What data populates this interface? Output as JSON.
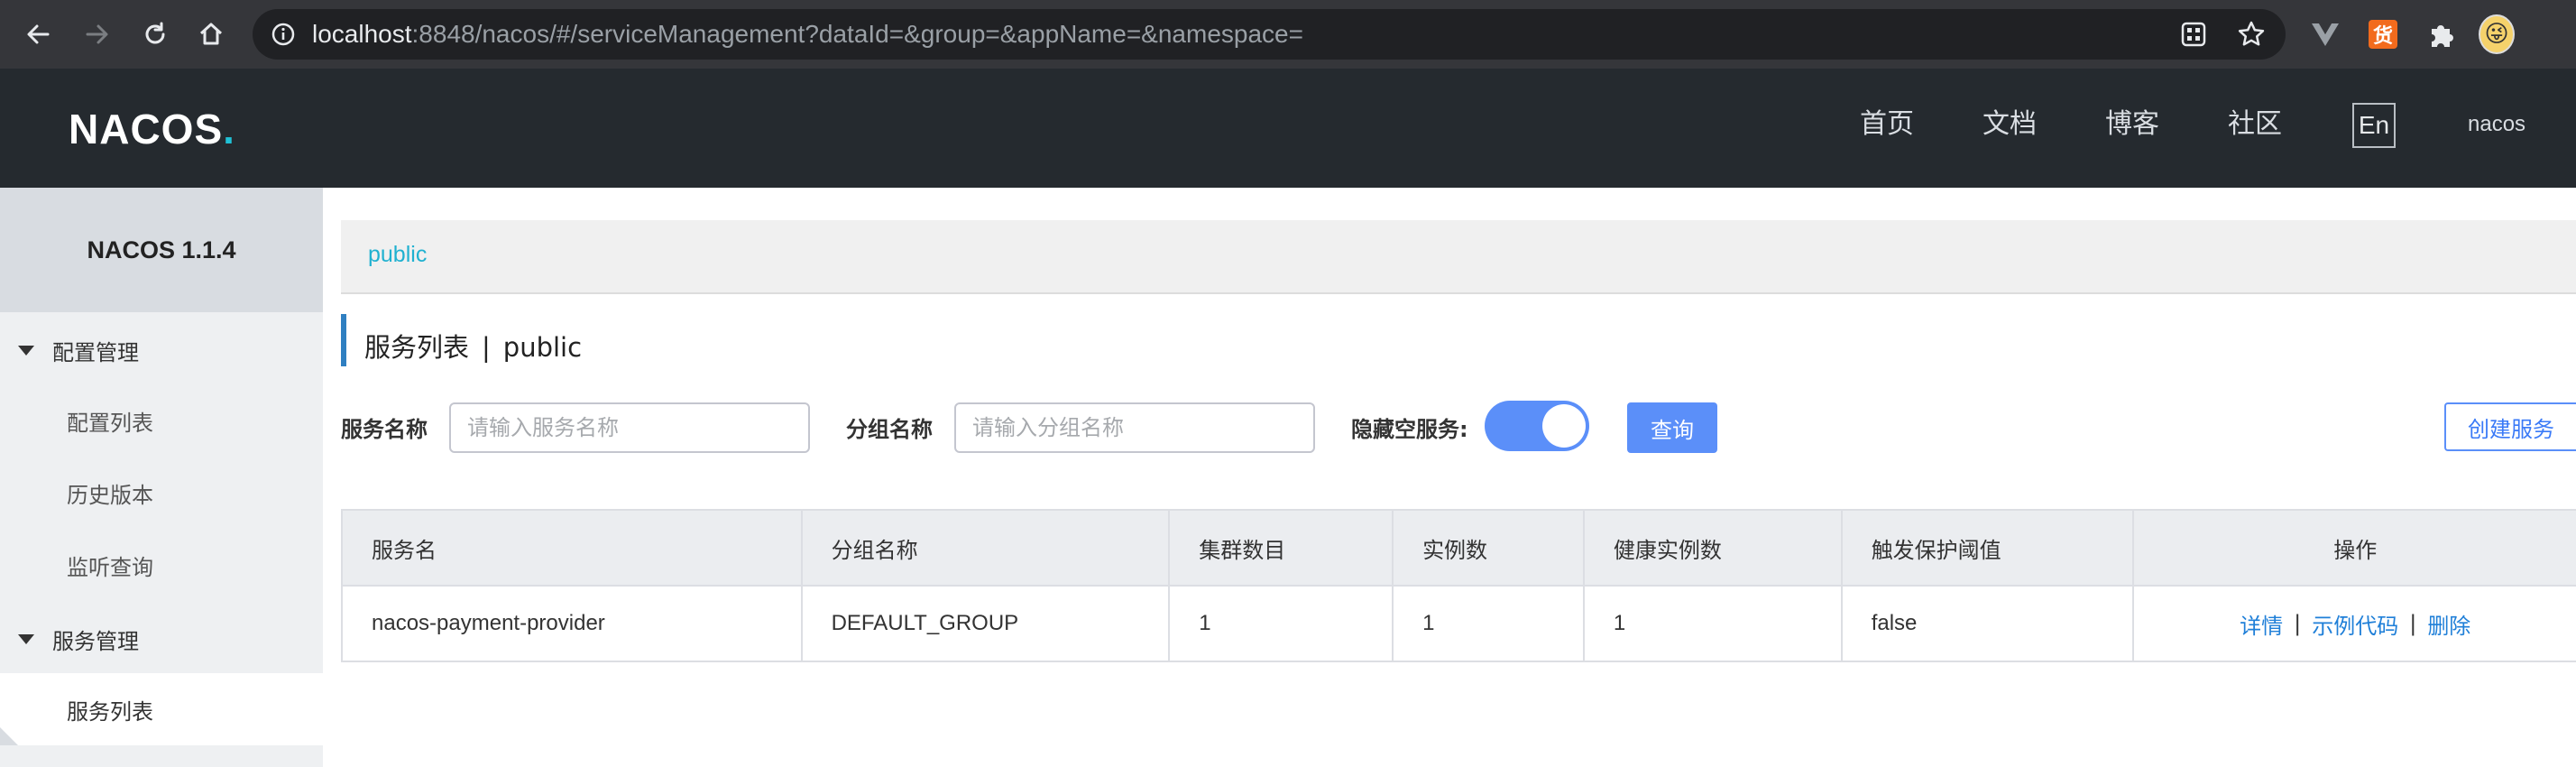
{
  "browser": {
    "url_host": "localhost",
    "url_rest": ":8848/nacos/#/serviceManagement?dataId=&group=&appName=&namespace=",
    "icons": [
      "back-icon",
      "forward-icon",
      "reload-icon",
      "home-icon",
      "info-icon",
      "qr-code-icon",
      "bookmark-star-icon",
      "vue-devtools-icon",
      "extension-badge-icon",
      "extensions-puzzle-icon",
      "profile-avatar-icon"
    ],
    "extension_badge_text": "货"
  },
  "header": {
    "logo_main": "NACOS",
    "logo_dot": ".",
    "nav": [
      "首页",
      "文档",
      "博客",
      "社区"
    ],
    "lang_button": "En",
    "user": "nacos"
  },
  "sidebar": {
    "version": "NACOS 1.1.4",
    "groups": [
      {
        "label": "配置管理",
        "items": [
          "配置列表",
          "历史版本",
          "监听查询"
        ]
      },
      {
        "label": "服务管理",
        "items": [
          "服务列表"
        ]
      }
    ]
  },
  "namespace_bar": {
    "link": "public"
  },
  "page": {
    "title": "服务列表",
    "separator": "|",
    "namespace": "public"
  },
  "filters": {
    "service_name_label": "服务名称",
    "service_name_placeholder": "请输入服务名称",
    "service_name_value": "",
    "group_name_label": "分组名称",
    "group_name_placeholder": "请输入分组名称",
    "group_name_value": "",
    "hide_empty_label": "隐藏空服务:",
    "hide_empty_on": true,
    "query_button": "查询",
    "create_button": "创建服务"
  },
  "table": {
    "headers": [
      "服务名",
      "分组名称",
      "集群数目",
      "实例数",
      "健康实例数",
      "触发保护阈值",
      "操作"
    ],
    "rows": [
      {
        "service": "nacos-payment-provider",
        "group": "DEFAULT_GROUP",
        "clusters": "1",
        "instances": "1",
        "healthy": "1",
        "threshold": "false",
        "actions": [
          "详情",
          "示例代码",
          "删除"
        ],
        "action_separator": "|"
      }
    ]
  },
  "colors": {
    "header_bg": "#252a2f",
    "accent_blue": "#5b8ff9",
    "link_blue": "#1f7fd8",
    "namespace_cyan": "#20b1d0"
  }
}
